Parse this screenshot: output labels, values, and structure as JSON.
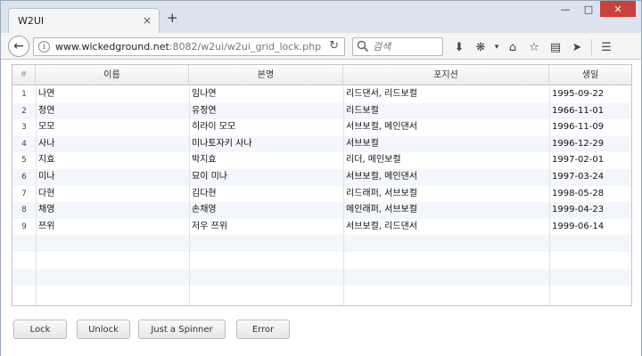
{
  "browser": {
    "tab_title": "W2UI",
    "tab_close": "×",
    "new_tab": "+",
    "url_host": "www.wickedground.net",
    "url_path": ":8082/w2ui/w2ui_grid_lock.php",
    "search_placeholder": "검색",
    "window_controls": {
      "minimize": "—",
      "maximize": "□",
      "close": "✕"
    }
  },
  "grid": {
    "columns": [
      "#",
      "이름",
      "본명",
      "포지션",
      "생일"
    ],
    "rows": [
      {
        "num": "1",
        "name": "나연",
        "realname": "임나연",
        "position": "리드댄서, 리드보컬",
        "birthday": "1995-09-22"
      },
      {
        "num": "2",
        "name": "정연",
        "realname": "유정연",
        "position": "리드보컬",
        "birthday": "1966-11-01"
      },
      {
        "num": "3",
        "name": "모모",
        "realname": "히라이 모모",
        "position": "서브보컬, 메인댄서",
        "birthday": "1996-11-09"
      },
      {
        "num": "4",
        "name": "사나",
        "realname": "미나토자키 사나",
        "position": "서브보컬",
        "birthday": "1996-12-29"
      },
      {
        "num": "5",
        "name": "지효",
        "realname": "박지효",
        "position": "리더, 메인보컬",
        "birthday": "1997-02-01"
      },
      {
        "num": "6",
        "name": "미나",
        "realname": "묘이 미나",
        "position": "서브보컬, 메인댄서",
        "birthday": "1997-03-24"
      },
      {
        "num": "7",
        "name": "다현",
        "realname": "김다현",
        "position": "리드래퍼, 서브보컬",
        "birthday": "1998-05-28"
      },
      {
        "num": "8",
        "name": "채영",
        "realname": "손채영",
        "position": "메인래퍼, 서브보컬",
        "birthday": "1999-04-23"
      },
      {
        "num": "9",
        "name": "쯔위",
        "realname": "저우 쯔위",
        "position": "서브보컬, 리드댄서",
        "birthday": "1999-06-14"
      }
    ]
  },
  "buttons": {
    "lock": "Lock",
    "unlock": "Unlock",
    "spinner": "Just a Spinner",
    "error": "Error"
  }
}
